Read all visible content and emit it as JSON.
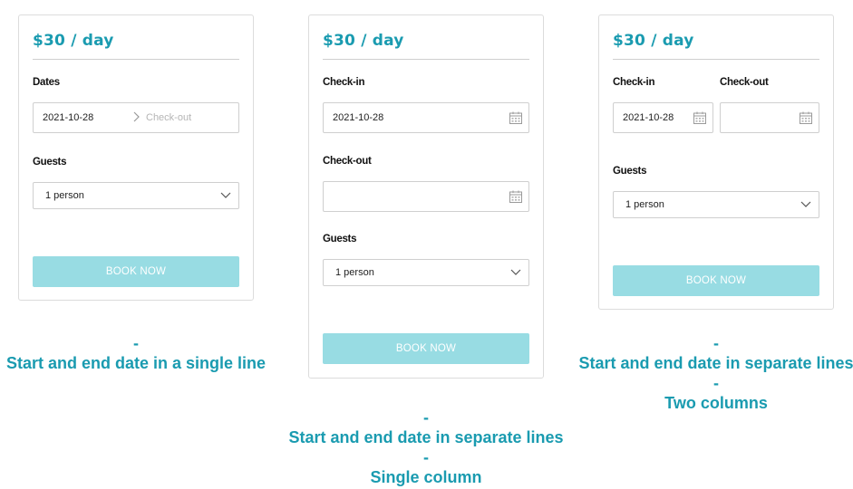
{
  "variants": [
    {
      "price": "$30 / day",
      "dates_label": "Dates",
      "checkin_value": "2021-10-28",
      "checkout_placeholder": "Check-out",
      "guests_label": "Guests",
      "guests_value": "1 person",
      "book_label": "BOOK NOW",
      "caption": [
        "-",
        "Start and end date in a single line"
      ]
    },
    {
      "price": "$30 / day",
      "checkin_label": "Check-in",
      "checkin_value": "2021-10-28",
      "checkout_label": "Check-out",
      "checkout_value": "",
      "guests_label": "Guests",
      "guests_value": "1 person",
      "book_label": "BOOK NOW",
      "caption": [
        "-",
        "Start and end date in separate lines",
        "-",
        "Single column"
      ]
    },
    {
      "price": "$30 / day",
      "checkin_label": "Check-in",
      "checkin_value": "2021-10-28",
      "checkout_label": "Check-out",
      "checkout_value": "",
      "guests_label": "Guests",
      "guests_value": "1 person",
      "book_label": "BOOK NOW",
      "caption": [
        "-",
        "Start and end date in separate lines",
        "-",
        "Two columns"
      ]
    }
  ],
  "icons": {
    "calendar": "calendar-icon",
    "chevron_right": "chevron-right-icon",
    "chevron_down": "chevron-down-icon"
  },
  "colors": {
    "accent": "#1a9bb0",
    "button": "#98dce3",
    "border": "#cfcfcf"
  }
}
